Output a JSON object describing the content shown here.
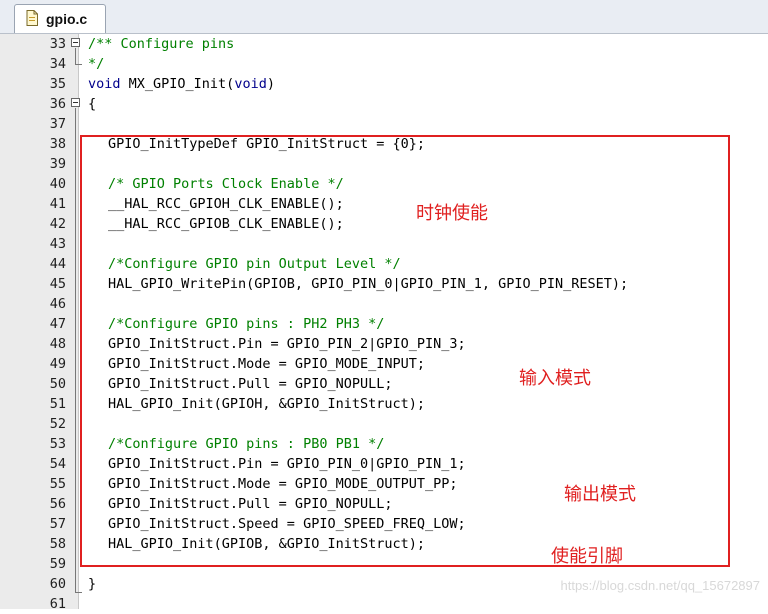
{
  "tab": {
    "label": "gpio.c",
    "icon": "c-file-icon"
  },
  "code_lines": [
    {
      "num": "33",
      "text": "/** Configure pins",
      "style": "comment",
      "indent": false,
      "fold": "open"
    },
    {
      "num": "34",
      "text": "*/",
      "style": "comment",
      "indent": false,
      "fold": "end"
    },
    {
      "num": "35",
      "text": "void MX_GPIO_Init(void)",
      "style": "kw",
      "indent": false,
      "fold": ""
    },
    {
      "num": "36",
      "text": "{",
      "style": "plain",
      "indent": false,
      "fold": "open"
    },
    {
      "num": "37",
      "text": "",
      "style": "plain",
      "indent": false,
      "fold": ""
    },
    {
      "num": "38",
      "text": "GPIO_InitTypeDef GPIO_InitStruct = {0};",
      "style": "plain",
      "indent": true,
      "fold": ""
    },
    {
      "num": "39",
      "text": "",
      "style": "plain",
      "indent": false,
      "fold": ""
    },
    {
      "num": "40",
      "text": "/* GPIO Ports Clock Enable */",
      "style": "comment",
      "indent": true,
      "fold": ""
    },
    {
      "num": "41",
      "text": "__HAL_RCC_GPIOH_CLK_ENABLE();",
      "style": "plain",
      "indent": true,
      "fold": ""
    },
    {
      "num": "42",
      "text": "__HAL_RCC_GPIOB_CLK_ENABLE();",
      "style": "plain",
      "indent": true,
      "fold": ""
    },
    {
      "num": "43",
      "text": "",
      "style": "plain",
      "indent": false,
      "fold": ""
    },
    {
      "num": "44",
      "text": "/*Configure GPIO pin Output Level */",
      "style": "comment",
      "indent": true,
      "fold": ""
    },
    {
      "num": "45",
      "text": "HAL_GPIO_WritePin(GPIOB, GPIO_PIN_0|GPIO_PIN_1, GPIO_PIN_RESET);",
      "style": "plain",
      "indent": true,
      "fold": ""
    },
    {
      "num": "46",
      "text": "",
      "style": "plain",
      "indent": false,
      "fold": ""
    },
    {
      "num": "47",
      "text": "/*Configure GPIO pins : PH2 PH3 */",
      "style": "comment",
      "indent": true,
      "fold": ""
    },
    {
      "num": "48",
      "text": "GPIO_InitStruct.Pin = GPIO_PIN_2|GPIO_PIN_3;",
      "style": "plain",
      "indent": true,
      "fold": ""
    },
    {
      "num": "49",
      "text": "GPIO_InitStruct.Mode = GPIO_MODE_INPUT;",
      "style": "plain",
      "indent": true,
      "fold": ""
    },
    {
      "num": "50",
      "text": "GPIO_InitStruct.Pull = GPIO_NOPULL;",
      "style": "plain",
      "indent": true,
      "fold": ""
    },
    {
      "num": "51",
      "text": "HAL_GPIO_Init(GPIOH, &GPIO_InitStruct);",
      "style": "plain",
      "indent": true,
      "fold": ""
    },
    {
      "num": "52",
      "text": "",
      "style": "plain",
      "indent": false,
      "fold": ""
    },
    {
      "num": "53",
      "text": "/*Configure GPIO pins : PB0 PB1 */",
      "style": "comment",
      "indent": true,
      "fold": ""
    },
    {
      "num": "54",
      "text": "GPIO_InitStruct.Pin = GPIO_PIN_0|GPIO_PIN_1;",
      "style": "plain",
      "indent": true,
      "fold": ""
    },
    {
      "num": "55",
      "text": "GPIO_InitStruct.Mode = GPIO_MODE_OUTPUT_PP;",
      "style": "plain",
      "indent": true,
      "fold": ""
    },
    {
      "num": "56",
      "text": "GPIO_InitStruct.Pull = GPIO_NOPULL;",
      "style": "plain",
      "indent": true,
      "fold": ""
    },
    {
      "num": "57",
      "text": "GPIO_InitStruct.Speed = GPIO_SPEED_FREQ_LOW;",
      "style": "plain",
      "indent": true,
      "fold": ""
    },
    {
      "num": "58",
      "text": "HAL_GPIO_Init(GPIOB, &GPIO_InitStruct);",
      "style": "plain",
      "indent": true,
      "fold": ""
    },
    {
      "num": "59",
      "text": "",
      "style": "plain",
      "indent": false,
      "fold": ""
    },
    {
      "num": "60",
      "text": "}",
      "style": "plain",
      "indent": false,
      "fold": ""
    },
    {
      "num": "61",
      "text": "",
      "style": "plain",
      "indent": false,
      "fold": ""
    }
  ],
  "annotations": {
    "clock_enable": "时钟使能",
    "input_mode": "输入模式",
    "output_mode": "输出模式",
    "enable_pins": "使能引脚"
  },
  "watermark": "https://blog.csdn.net/qq_15672897",
  "colors": {
    "comment": "#008000",
    "keyword": "#00008b",
    "annotation": "#e02020",
    "gutter": "#ebebeb"
  }
}
